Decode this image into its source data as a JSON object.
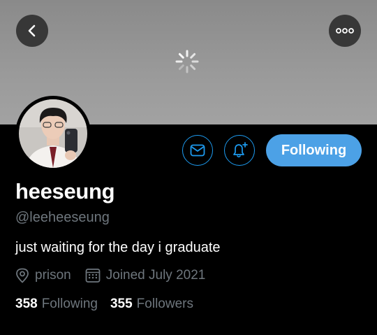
{
  "header": {
    "back_icon": "chevron-left-icon",
    "more_icon": "more-options-icon",
    "loading_icon": "loading-spinner-icon"
  },
  "profile": {
    "display_name": "heeseung",
    "handle": "@leeheeseung",
    "bio": "just waiting for the day i graduate",
    "location": "prison",
    "joined": "Joined July 2021"
  },
  "actions": {
    "message_icon": "envelope-icon",
    "notify_icon": "bell-plus-icon",
    "follow_label": "Following"
  },
  "stats": {
    "following_count": "358",
    "following_label": "Following",
    "followers_count": "355",
    "followers_label": "Followers"
  },
  "colors": {
    "accent": "#1d9bf0",
    "follow_button": "#4ca1e6",
    "muted_text": "#6e767d",
    "background": "#000000"
  }
}
